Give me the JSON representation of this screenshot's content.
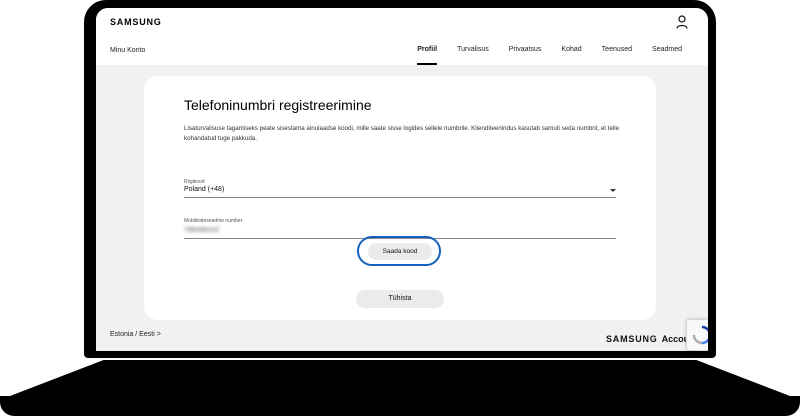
{
  "header": {
    "logo": "SAMSUNG",
    "account_title": "Minu Konto",
    "tabs": [
      "Profiil",
      "Turvalisus",
      "Privaatsus",
      "Kohad",
      "Teenused",
      "Seadmed"
    ],
    "active_tab": "Profiil"
  },
  "card": {
    "title": "Telefoninumbri registreerimine",
    "description": "Lisaturvalisuse tagamiseks peate sisestama ainulaadse koodi, mille saate sisse logides sellele numbrile. Klienditeenindus kasutab samuti seda numbrit, et teile kohandatud tuge pakkuda.",
    "country_label": "Riigikood",
    "country_value": "Poland (+48)",
    "phone_label": "Mobiilsideseadme number",
    "phone_value": "796499102",
    "send_button": "Saada kood",
    "cancel_button": "Tühista"
  },
  "footer": {
    "locale": "Estonia / Eesti",
    "locale_chevron": ">",
    "brand_samsung": "SAMSUNG",
    "brand_account": "Accoun"
  },
  "icons": {
    "profile": "user-icon",
    "dropdown": "chevron-down-icon",
    "recaptcha": "recaptcha-icon"
  },
  "colors": {
    "highlight": "#1660c0",
    "button_bg": "#ebebeb",
    "page_bg": "#f1f1f1"
  }
}
